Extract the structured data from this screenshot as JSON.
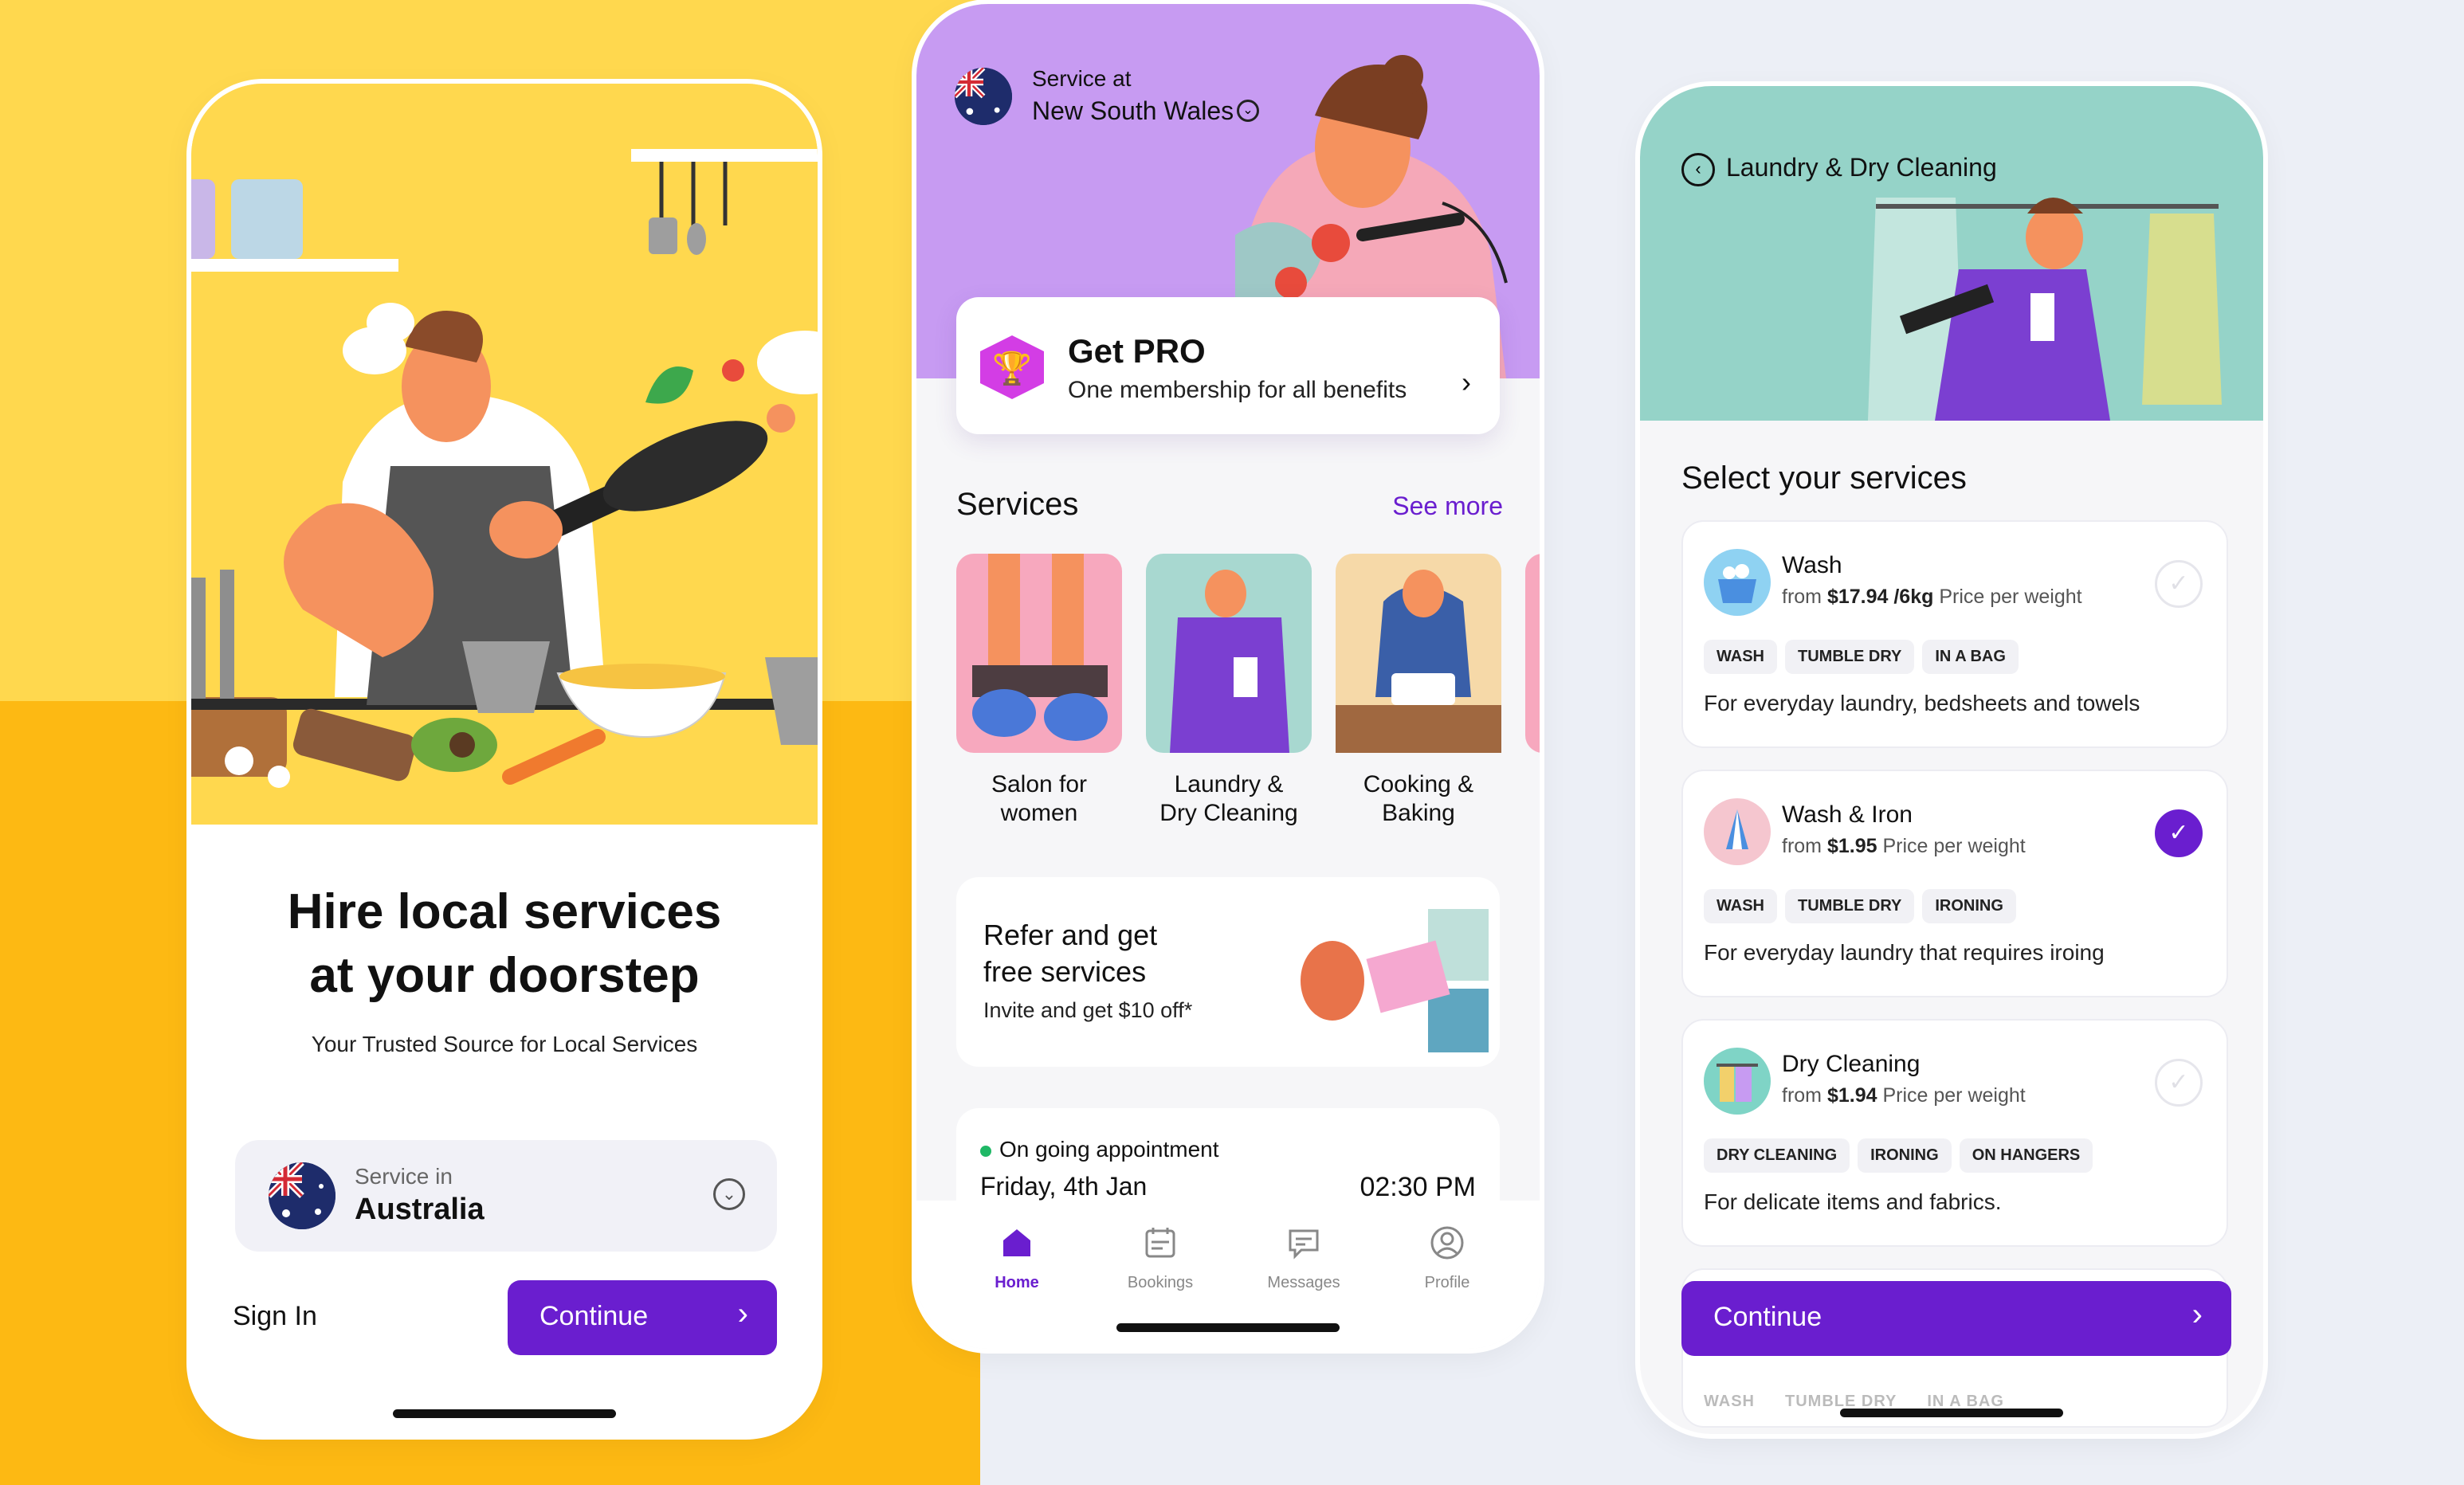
{
  "colors": {
    "accent": "#6A1ECF",
    "yellow": "#FFD84E",
    "orange": "#FDB913",
    "lilac": "#C79BF2",
    "teal": "#95D3C8",
    "online": "#1FB866"
  },
  "screen1": {
    "title_line1": "Hire local services",
    "title_line2": "at your doorstep",
    "subtitle": "Your Trusted Source for Local Services",
    "country_label": "Service in",
    "country_value": "Australia",
    "sign_in": "Sign In",
    "continue": "Continue"
  },
  "screen2": {
    "service_at_label": "Service at",
    "region": "New South Wales",
    "pro": {
      "title": "Get PRO",
      "subtitle": "One membership for all benefits"
    },
    "services_heading": "Services",
    "see_more": "See more",
    "services": [
      {
        "line1": "Salon for",
        "line2": "women"
      },
      {
        "line1": "Laundry &",
        "line2": "Dry Cleaning"
      },
      {
        "line1": "Cooking &",
        "line2": "Baking"
      }
    ],
    "refer": {
      "line1": "Refer and get",
      "line2": "free services",
      "sub": "Invite and get $10 off*"
    },
    "appointment": {
      "status": "On going appointment",
      "date": "Friday, 4th Jan",
      "time": "02:30 PM"
    },
    "tabs": [
      {
        "label": "Home",
        "icon": "home-icon"
      },
      {
        "label": "Bookings",
        "icon": "calendar-icon"
      },
      {
        "label": "Messages",
        "icon": "chat-icon"
      },
      {
        "label": "Profile",
        "icon": "profile-icon"
      }
    ]
  },
  "screen3": {
    "title": "Laundry & Dry Cleaning",
    "select_heading": "Select your services",
    "options": [
      {
        "name": "Wash",
        "price_prefix": "from",
        "price": "$17.94 /6kg",
        "price_suffix": "Price per weight",
        "tags": [
          "WASH",
          "TUMBLE DRY",
          "IN A BAG"
        ],
        "desc": "For everyday laundry, bedsheets and towels",
        "selected": false
      },
      {
        "name": "Wash & Iron",
        "price_prefix": "from",
        "price": "$1.95",
        "price_suffix": "Price per weight",
        "tags": [
          "WASH",
          "TUMBLE DRY",
          "IRONING"
        ],
        "desc": "For everyday laundry that requires iroing",
        "selected": true
      },
      {
        "name": "Dry Cleaning",
        "price_prefix": "from",
        "price": "$1.94",
        "price_suffix": "Price per weight",
        "tags": [
          "DRY CLEANING",
          "IRONING",
          "ON HANGERS"
        ],
        "desc": "For delicate items and fabrics.",
        "selected": false
      }
    ],
    "continue": "Continue",
    "ghost_tags": [
      "WASH",
      "TUMBLE DRY",
      "IN A BAG"
    ]
  }
}
